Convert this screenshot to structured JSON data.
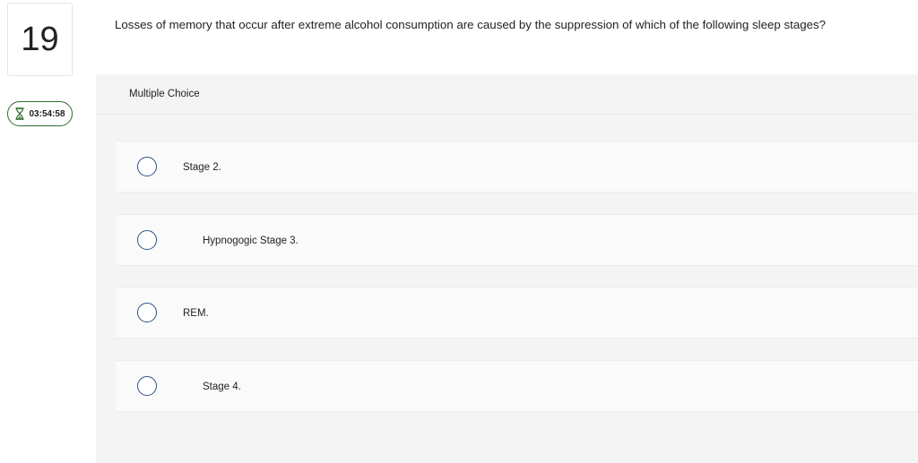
{
  "question": {
    "number": "19",
    "timer": "03:54:58",
    "prompt": "Losses of memory that occur after extreme alcohol consumption are caused by the suppression of which of the following sleep stages?"
  },
  "answer_section": {
    "type_label": "Multiple Choice",
    "options": [
      {
        "label": "Stage 2."
      },
      {
        "label": "Hypnogogic Stage 3."
      },
      {
        "label": "REM."
      },
      {
        "label": "Stage 4."
      }
    ]
  },
  "colors": {
    "timer_border": "#2f6b2f",
    "radio_border": "#2a4f86",
    "panel_bg": "#f4f4f4"
  },
  "icons": {
    "timer": "hourglass-icon",
    "option": "radio-button"
  }
}
